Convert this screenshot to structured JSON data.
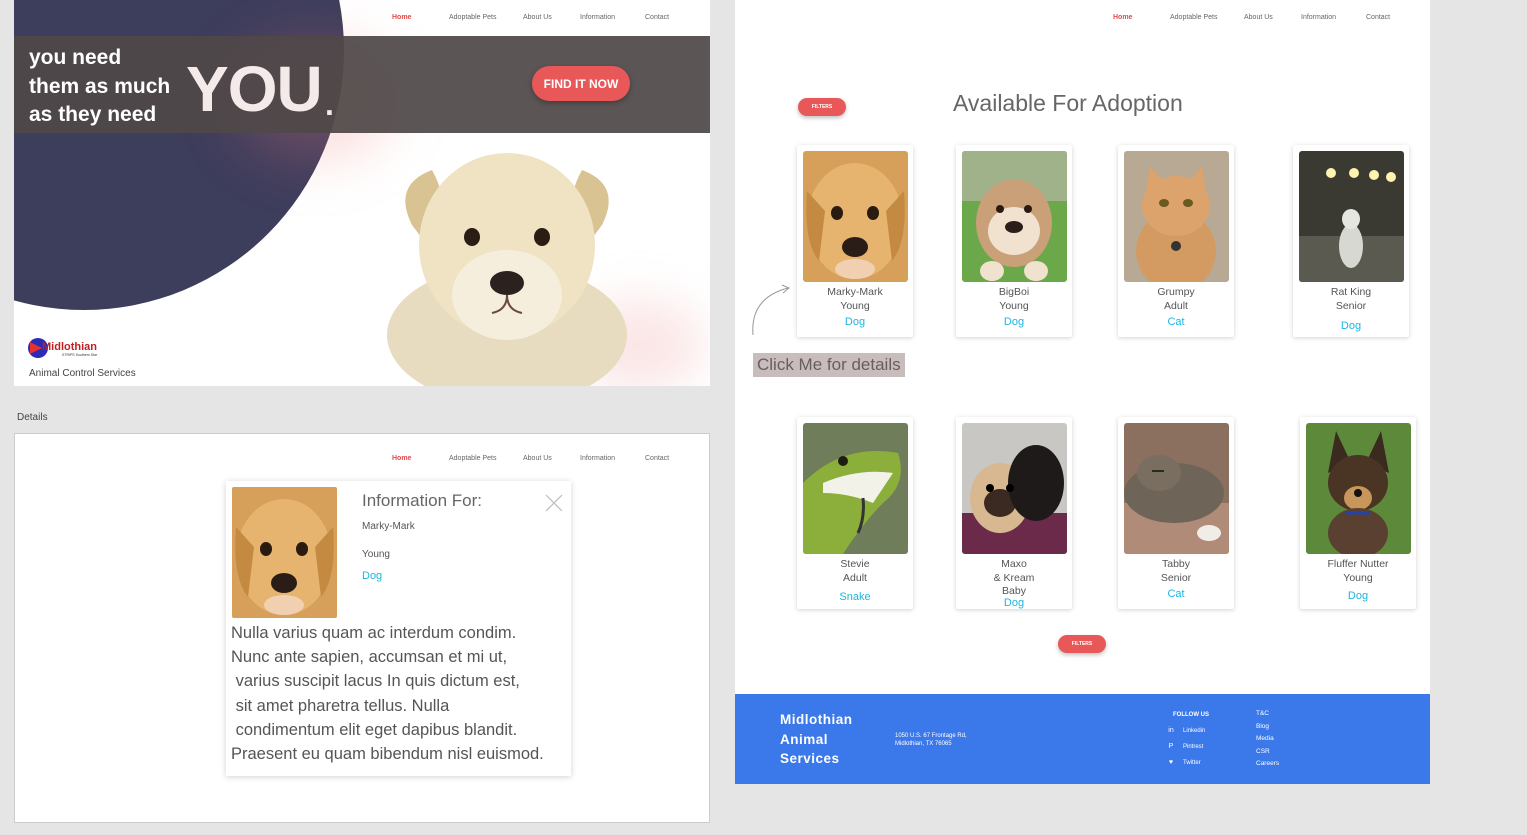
{
  "nav": {
    "items": [
      "Home",
      "Adoptable Pets",
      "About Us",
      "Information",
      "Contact"
    ]
  },
  "home": {
    "tagline": [
      "you need",
      "them as much",
      "as they need"
    ],
    "you_text": "YOU",
    "you_dot": ".",
    "cta_label": "FIND IT NOW",
    "logo_text": "Midlothian",
    "logo_subtext": "STRIPS Southern Star",
    "service_name": "Animal Control Services"
  },
  "details": {
    "artboard_label": "Details",
    "info_title": "Information For:",
    "pet_name": "Marky-Mark",
    "pet_age": "Young",
    "pet_type": "Dog",
    "description": "Nulla varius quam ac interdum condim.\nNunc ante sapien, accumsan et mi ut,\n varius suscipit lacus In quis dictum est,\n sit amet pharetra tellus. Nulla\n condimentum elit eget dapibus blandit.\nPraesent eu quam bibendum nisl euismod."
  },
  "adopt": {
    "filters_label": "FILTERS",
    "title": "Available For Adoption",
    "click_hint": "Click Me for details",
    "pets": [
      {
        "name": "Marky-Mark",
        "age": "Young",
        "type": "Dog",
        "image": "golden-puppy"
      },
      {
        "name": "BigBoi",
        "age": "Young",
        "type": "Dog",
        "image": "bulldog"
      },
      {
        "name": "Grumpy",
        "age": "Adult",
        "type": "Cat",
        "image": "orange-cat"
      },
      {
        "name": "Rat King",
        "age": "Senior",
        "type": "Dog",
        "image": "crested-dog"
      },
      {
        "name": "Stevie",
        "age": "Adult",
        "type": "Snake",
        "image": "green-snake"
      },
      {
        "name": "Maxo",
        "age": "& Kream",
        "stage": "Baby",
        "type": "Dog",
        "image": "two-pugs"
      },
      {
        "name": "Tabby",
        "age": "Senior",
        "type": "Cat",
        "image": "tabby-cat"
      },
      {
        "name": "Fluffer Nutter",
        "age": "Young",
        "type": "Dog",
        "image": "shepherd-puppy"
      }
    ]
  },
  "footer": {
    "brand": [
      "Midlothian",
      "Animal",
      "Services"
    ],
    "address": [
      "1050 U.S. 67 Frontage Rd,",
      "Midlothian, TX 76065"
    ],
    "follow_label": "FOLLOW US",
    "social": [
      {
        "icon": "linkedin-icon",
        "glyph": "in",
        "label": "Linkedin"
      },
      {
        "icon": "pinterest-icon",
        "glyph": "P",
        "label": "Pintrest"
      },
      {
        "icon": "twitter-icon",
        "glyph": "♥",
        "label": "Twitter"
      }
    ],
    "links": [
      "T&C",
      "Blog",
      "Media",
      "CSR",
      "Careers"
    ]
  },
  "colors": {
    "accent": "#e85858",
    "active_nav": "#e04b4b",
    "type_link": "#1db5e0",
    "footer_bg": "#3b78ea",
    "hero_blob": "#3d3d5c"
  }
}
